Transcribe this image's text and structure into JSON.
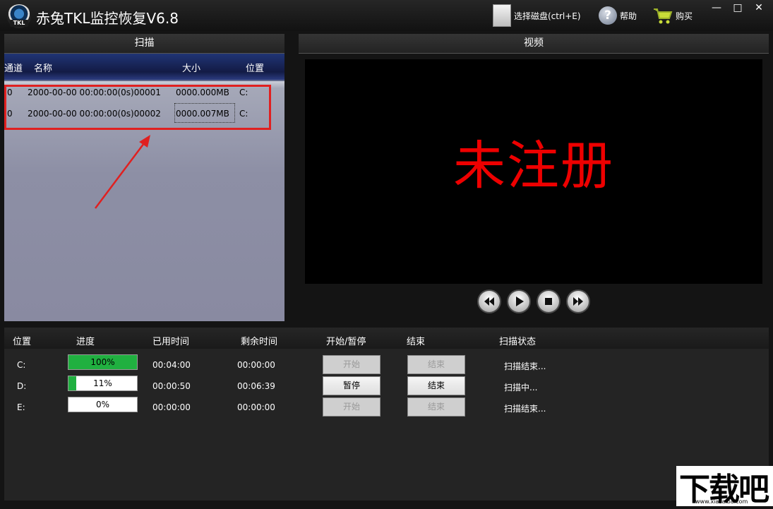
{
  "app": {
    "title": "赤兔TKL监控恢复V6.8",
    "logo_text": "TKL"
  },
  "toolbar": {
    "select_disk": "选择磁盘(ctrl+E)",
    "help": "帮助",
    "buy": "购买"
  },
  "window_controls": {
    "minimize": "—",
    "maximize": "□",
    "close": "✕"
  },
  "scan": {
    "title": "扫描",
    "columns": [
      "通道",
      "名称",
      "大小",
      "位置"
    ],
    "rows": [
      {
        "channel": "0",
        "name": "2000-00-00 00:00:00(0s)00001",
        "size": "0000.000MB",
        "location": "C:"
      },
      {
        "channel": "0",
        "name": "2000-00-00 00:00:00(0s)00002",
        "size": "0000.007MB",
        "location": "C:"
      }
    ]
  },
  "video": {
    "title": "视频",
    "overlay": "未注册"
  },
  "progress": {
    "columns": [
      "位置",
      "进度",
      "已用时间",
      "剩余时间",
      "开始/暂停",
      "结束",
      "扫描状态"
    ],
    "rows": [
      {
        "location": "C:",
        "progress_label": "100%",
        "progress": 1.0,
        "elapsed": "00:04:00",
        "remaining": "00:00:00",
        "start_pause": "开始",
        "end": "结束",
        "status": "扫描结束..."
      },
      {
        "location": "D:",
        "progress_label": "11%",
        "progress": 0.11,
        "elapsed": "00:00:50",
        "remaining": "00:06:39",
        "start_pause": "暂停",
        "end": "结束",
        "status": "扫描中..."
      },
      {
        "location": "E:",
        "progress_label": "0%",
        "progress": 0.0,
        "elapsed": "00:00:00",
        "remaining": "00:00:00",
        "start_pause": "开始",
        "end": "结束",
        "status": "扫描结束..."
      }
    ]
  },
  "watermark": {
    "text": "下载吧",
    "url": "www.xiazaiba.com"
  },
  "colors": {
    "highlight": "#e02020",
    "unregistered": "#ee0000",
    "progress_fill": "#20b040"
  }
}
